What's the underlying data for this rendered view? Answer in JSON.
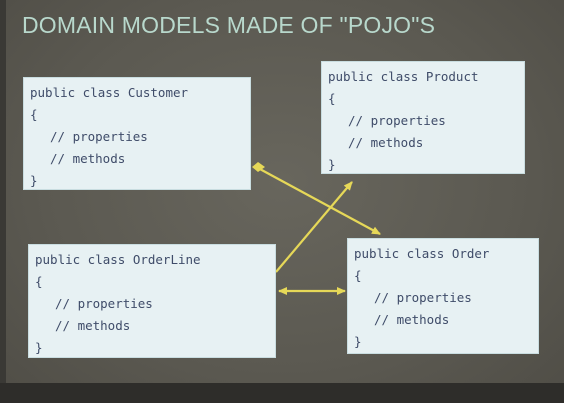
{
  "title": "DOMAIN MODELS MADE OF \"POJO\"S",
  "diagram": {
    "nodes": [
      {
        "id": "customer",
        "header": "public class Customer",
        "open": "{",
        "properties": "// properties",
        "methods": "// methods",
        "close": "}"
      },
      {
        "id": "product",
        "header": "public class Product",
        "open": "{",
        "properties": "// properties",
        "methods": "// methods",
        "close": "}"
      },
      {
        "id": "orderline",
        "header": "public class OrderLine",
        "open": "{",
        "properties": "// properties",
        "methods": "// methods",
        "close": "}"
      },
      {
        "id": "order",
        "header": "public class Order",
        "open": "{",
        "properties": "// properties",
        "methods": "// methods",
        "close": "}"
      }
    ],
    "edges": [
      {
        "from": "customer",
        "to": "order",
        "style": "diamond-arrow"
      },
      {
        "from": "orderline",
        "to": "product",
        "style": "arrow"
      },
      {
        "from": "orderline",
        "to": "order",
        "style": "bidirectional-arrow"
      }
    ]
  },
  "colors": {
    "background": "#5e5d55",
    "title": "#b8d8cc",
    "box": "#e7f1f3",
    "code_text": "#3f4c69",
    "connector": "#e6d858"
  }
}
